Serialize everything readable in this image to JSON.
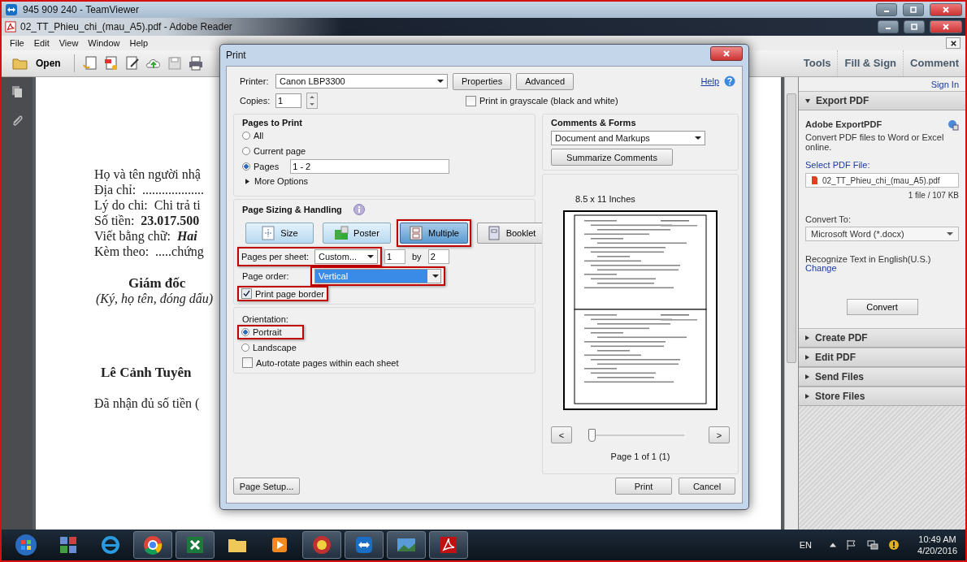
{
  "teamviewer": {
    "title": "945 909 240 - TeamViewer"
  },
  "reader": {
    "title": "02_TT_Phieu_chi_(mau_A5).pdf - Adobe Reader",
    "menu": [
      "File",
      "Edit",
      "View",
      "Window",
      "Help"
    ],
    "open": "Open",
    "panes": [
      "Tools",
      "Fill & Sign",
      "Comment"
    ]
  },
  "document": {
    "lines": [
      {
        "kind": "line",
        "label": "Họ và tên người nhậ"
      },
      {
        "kind": "line",
        "label": "Địa chỉ:  ..................."
      },
      {
        "kind": "field",
        "label": "Lý do chi:",
        "value": "Chi trả ti"
      },
      {
        "kind": "amount",
        "label": "Số tiền:",
        "value": "23.017.500"
      },
      {
        "kind": "words",
        "label": "Viết bằng chữ:",
        "value": "Hai"
      },
      {
        "kind": "field",
        "label": "Kèm theo:",
        "value": ".....chứng"
      },
      {
        "kind": "heading",
        "label": "Giám đốc"
      },
      {
        "kind": "note",
        "label": "(Ký, họ tên, đóng dấu)"
      },
      {
        "kind": "name",
        "label": "Lê Cảnh Tuyên"
      },
      {
        "kind": "text",
        "label": "Đã nhận đủ số tiền ("
      }
    ]
  },
  "side_panel": {
    "sign_in": "Sign In",
    "export": {
      "title": "Export PDF",
      "expanded": true,
      "heading": "Adobe ExportPDF",
      "description": "Convert PDF files to Word or Excel online.",
      "select_label": "Select PDF File:",
      "file": "02_TT_Phieu_chi_(mau_A5).pdf",
      "size": "1 file / 107 KB",
      "convert_to_label": "Convert To:",
      "convert_to": "Microsoft Word (*.docx)",
      "recognize": "Recognize Text in English(U.S.)",
      "change": "Change",
      "button": "Convert"
    },
    "sections": [
      {
        "title": "Create PDF",
        "expanded": false
      },
      {
        "title": "Edit PDF",
        "expanded": false
      },
      {
        "title": "Send Files",
        "expanded": false
      },
      {
        "title": "Store Files",
        "expanded": false
      }
    ]
  },
  "print_dialog": {
    "title": "Print",
    "printer_label": "Printer:",
    "printer": "Canon LBP3300",
    "properties": "Properties",
    "advanced": "Advanced",
    "help": "Help",
    "copies_label": "Copies:",
    "copies": "1",
    "grayscale": {
      "label": "Print in grayscale (black and white)",
      "checked": false
    },
    "pages_to_print": {
      "title": "Pages to Print",
      "options": [
        {
          "label": "All",
          "selected": false
        },
        {
          "label": "Current page",
          "selected": false
        },
        {
          "label": "Pages",
          "selected": true
        }
      ],
      "range": "1 - 2",
      "more": "More Options"
    },
    "sizing": {
      "title": "Page Sizing & Handling",
      "modes": [
        {
          "label": "Size",
          "kind": "size",
          "selected": false
        },
        {
          "label": "Poster",
          "kind": "poster",
          "selected": false
        },
        {
          "label": "Multiple",
          "kind": "multiple",
          "selected": true,
          "highlighted": true
        },
        {
          "label": "Booklet",
          "kind": "booklet",
          "selected": false
        }
      ],
      "pages_per_sheet": {
        "label": "Pages per sheet:",
        "value": "Custom...",
        "columns": "1",
        "by": "by",
        "rows": "2",
        "highlighted": true
      },
      "page_order": {
        "label": "Page order:",
        "value": "Vertical",
        "highlighted": true
      },
      "border": {
        "label": "Print page border",
        "checked": true,
        "highlighted": true
      }
    },
    "orientation": {
      "title": "Orientation:",
      "options": [
        {
          "label": "Portrait",
          "selected": true,
          "highlighted": true
        },
        {
          "label": "Landscape",
          "selected": false
        }
      ],
      "auto_rotate": {
        "label": "Auto-rotate pages within each sheet",
        "checked": false
      }
    },
    "comments": {
      "title": "Comments & Forms",
      "value": "Document and Markups",
      "summarize": "Summarize Comments"
    },
    "preview": {
      "size": "8.5 x 11 Inches",
      "prev": "<",
      "next": ">",
      "slider": {
        "level": 0
      },
      "page": "Page 1 of 1 (1)"
    },
    "page_setup": "Page Setup...",
    "print": "Print",
    "cancel": "Cancel"
  },
  "taskbar": {
    "apps": [
      {
        "kind": "start",
        "active": false
      },
      {
        "kind": "tiles",
        "active": false
      },
      {
        "kind": "ie",
        "active": false
      },
      {
        "kind": "chrome",
        "active": true
      },
      {
        "kind": "excel",
        "active": true
      },
      {
        "kind": "folder",
        "active": false
      },
      {
        "kind": "media",
        "active": false
      },
      {
        "kind": "ring",
        "active": true
      },
      {
        "kind": "teamviewer",
        "active": true
      },
      {
        "kind": "photo",
        "active": true
      },
      {
        "kind": "acrobat",
        "active": true
      }
    ],
    "language": "EN",
    "time": "10:49 AM",
    "date": "4/20/2016"
  }
}
